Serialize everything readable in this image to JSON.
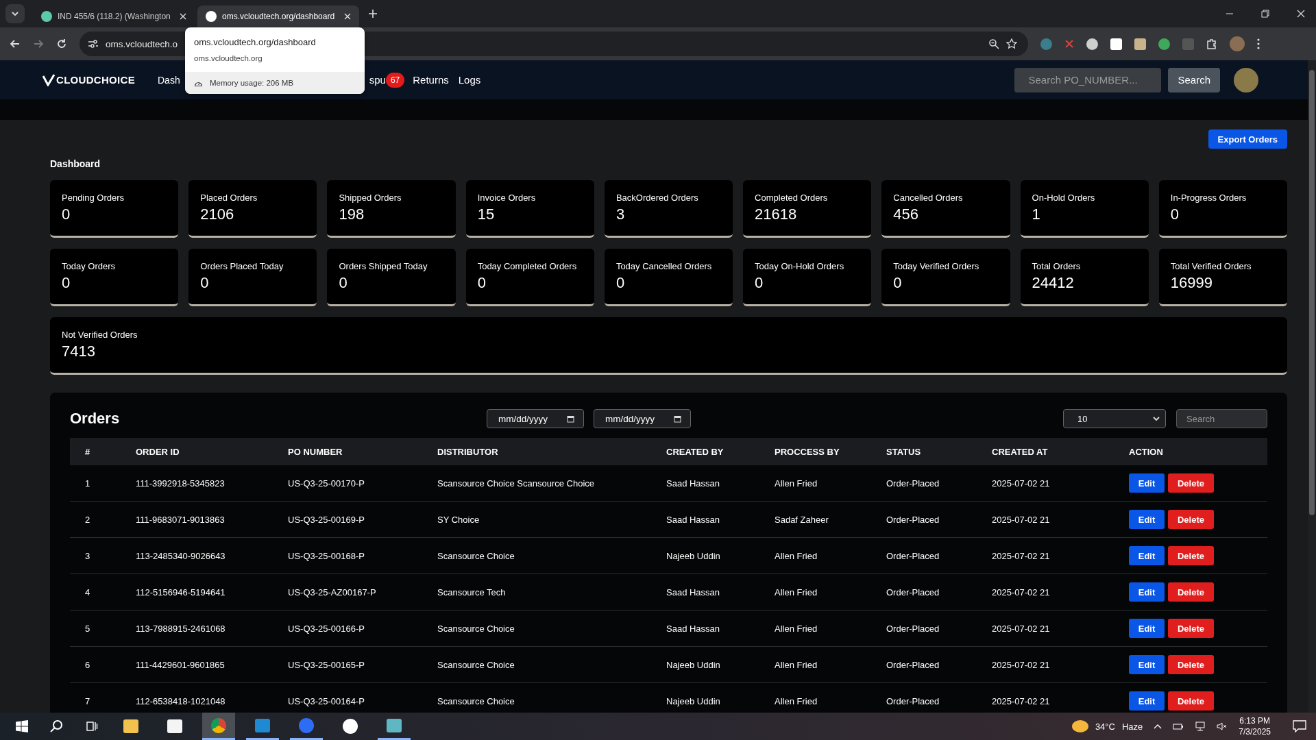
{
  "browser": {
    "tabs": [
      {
        "title": "IND 455/6 (118.2) (Washington",
        "selected": false
      },
      {
        "title": "oms.vcloudtech.org/dashboard",
        "selected": true
      }
    ],
    "address": "oms.vcloudtech.o",
    "hover_card": {
      "title": "oms.vcloudtech.org/dashboard",
      "domain": "oms.vcloudtech.org",
      "memory": "Memory usage: 206 MB"
    }
  },
  "app": {
    "logo": "CLOUDCHOICE",
    "nav": [
      {
        "label": "Dash"
      },
      {
        "label": "spu",
        "badge": "67"
      },
      {
        "label": "Returns"
      },
      {
        "label": "Logs"
      }
    ],
    "search": {
      "placeholder": "Search PO_NUMBER...",
      "button": "Search"
    }
  },
  "export_button": "Export Orders",
  "dashboard": {
    "title": "Dashboard",
    "stats": [
      {
        "label": "Pending Orders",
        "value": "0"
      },
      {
        "label": "Placed Orders",
        "value": "2106"
      },
      {
        "label": "Shipped Orders",
        "value": "198"
      },
      {
        "label": "Invoice Orders",
        "value": "15"
      },
      {
        "label": "BackOrdered Orders",
        "value": "3"
      },
      {
        "label": "Completed Orders",
        "value": "21618"
      },
      {
        "label": "Cancelled Orders",
        "value": "456"
      },
      {
        "label": "On-Hold Orders",
        "value": "1"
      },
      {
        "label": "In-Progress Orders",
        "value": "0"
      },
      {
        "label": "Today Orders",
        "value": "0"
      },
      {
        "label": "Orders Placed Today",
        "value": "0"
      },
      {
        "label": "Orders Shipped Today",
        "value": "0"
      },
      {
        "label": "Today Completed Orders",
        "value": "0"
      },
      {
        "label": "Today Cancelled Orders",
        "value": "0"
      },
      {
        "label": "Today On-Hold Orders",
        "value": "0"
      },
      {
        "label": "Today Verified Orders",
        "value": "0"
      },
      {
        "label": "Total Orders",
        "value": "24412"
      },
      {
        "label": "Total Verified Orders",
        "value": "16999"
      }
    ],
    "summary": {
      "label": "Not Verified Orders",
      "value": "7413"
    }
  },
  "orders": {
    "title": "Orders",
    "date_filters": [
      {
        "placeholder": "mm/dd/yyyy"
      },
      {
        "placeholder": "mm/dd/yyyy"
      }
    ],
    "page_size": "10",
    "search": {
      "placeholder": "Search"
    },
    "columns": [
      "#",
      "ORDER ID",
      "PO NUMBER",
      "DISTRIBUTOR",
      "CREATED BY",
      "PROCCESS BY",
      "STATUS",
      "CREATED AT",
      "ACTION"
    ],
    "rows": [
      {
        "cells": [
          "1",
          "111-3992918-5345823",
          "US-Q3-25-00170-P",
          "Scansource Choice Scansource Choice",
          "Saad Hassan",
          "Allen Fried",
          "Order-Placed",
          "2025-07-02 21"
        ],
        "actions": [
          "Edit",
          "Delete"
        ]
      },
      {
        "cells": [
          "2",
          "111-9683071-9013863",
          "US-Q3-25-00169-P",
          "SY Choice",
          "Saad Hassan",
          "Sadaf Zaheer",
          "Order-Placed",
          "2025-07-02 21"
        ],
        "actions": [
          "Edit",
          "Delete"
        ]
      },
      {
        "cells": [
          "3",
          "113-2485340-9026643",
          "US-Q3-25-00168-P",
          "Scansource Choice",
          "Najeeb Uddin",
          "Allen Fried",
          "Order-Placed",
          "2025-07-02 21"
        ],
        "actions": [
          "Edit",
          "Delete"
        ]
      },
      {
        "cells": [
          "4",
          "112-5156946-5194641",
          "US-Q3-25-AZ00167-P",
          "Scansource Tech",
          "Saad Hassan",
          "Allen Fried",
          "Order-Placed",
          "2025-07-02 21"
        ],
        "actions": [
          "Edit",
          "Delete"
        ]
      },
      {
        "cells": [
          "5",
          "113-7988915-2461068",
          "US-Q3-25-00166-P",
          "Scansource Choice",
          "Saad Hassan",
          "Allen Fried",
          "Order-Placed",
          "2025-07-02 21"
        ],
        "actions": [
          "Edit",
          "Delete"
        ]
      },
      {
        "cells": [
          "6",
          "111-4429601-9601865",
          "US-Q3-25-00165-P",
          "Scansource Choice",
          "Najeeb Uddin",
          "Allen Fried",
          "Order-Placed",
          "2025-07-02 21"
        ],
        "actions": [
          "Edit",
          "Delete"
        ]
      },
      {
        "cells": [
          "7",
          "112-6538418-1021048",
          "US-Q3-25-00164-P",
          "Scansource Choice",
          "Najeeb Uddin",
          "Allen Fried",
          "Order-Placed",
          "2025-07-02 21"
        ],
        "actions": [
          "Edit",
          "Delete"
        ]
      }
    ]
  },
  "taskbar": {
    "temperature": "34°C",
    "weather": "Haze",
    "time": "6:13 PM",
    "date": "7/3/2025"
  }
}
